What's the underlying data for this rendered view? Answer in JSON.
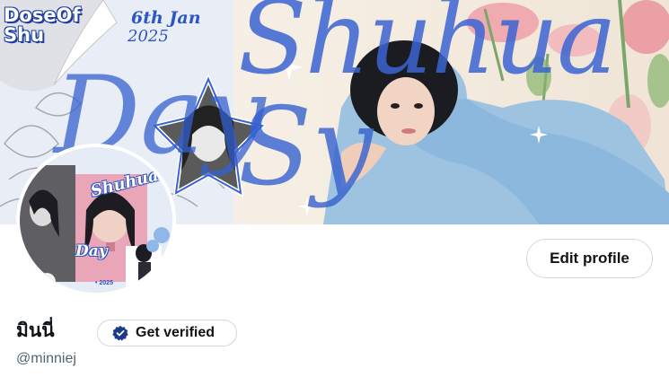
{
  "banner": {
    "dose_text": "DoseOf\nShu",
    "date_text": "6th Jan",
    "year_text": "2025",
    "big_text": "Shuhua",
    "big_text_2": "Day",
    "big_text_3": "Sy"
  },
  "avatar": {
    "title": "Shuhua's",
    "day": "Day",
    "year": "• 2025"
  },
  "profile": {
    "edit_label": "Edit profile",
    "display_name": "มินนี่",
    "verify_label": "Get verified",
    "handle": "@minniej"
  },
  "colors": {
    "accent_blue": "#2c56c5",
    "border": "#cfd9de",
    "muted_text": "#536471",
    "text": "#0f1419"
  },
  "icons": {
    "verify": "verified-badge-icon"
  }
}
